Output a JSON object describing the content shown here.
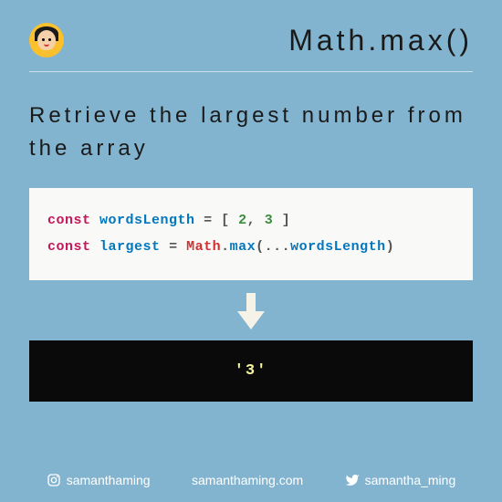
{
  "header": {
    "title": "Math.max()"
  },
  "subtitle": "Retrieve the largest number from the array",
  "code": {
    "line1": {
      "kw": "const",
      "var": "wordsLength",
      "eq": "=",
      "open": "[",
      "n1": "2",
      "comma": ",",
      "n2": "3",
      "close": "]"
    },
    "line2": {
      "kw": "const",
      "var": "largest",
      "eq": "=",
      "cls": "Math",
      "dot": ".",
      "method": "max",
      "open": "(",
      "spread": "...",
      "arg": "wordsLength",
      "close": ")"
    }
  },
  "output": "'3'",
  "footer": {
    "instagram": "samanthaming",
    "website": "samanthaming.com",
    "twitter": "samantha_ming"
  }
}
